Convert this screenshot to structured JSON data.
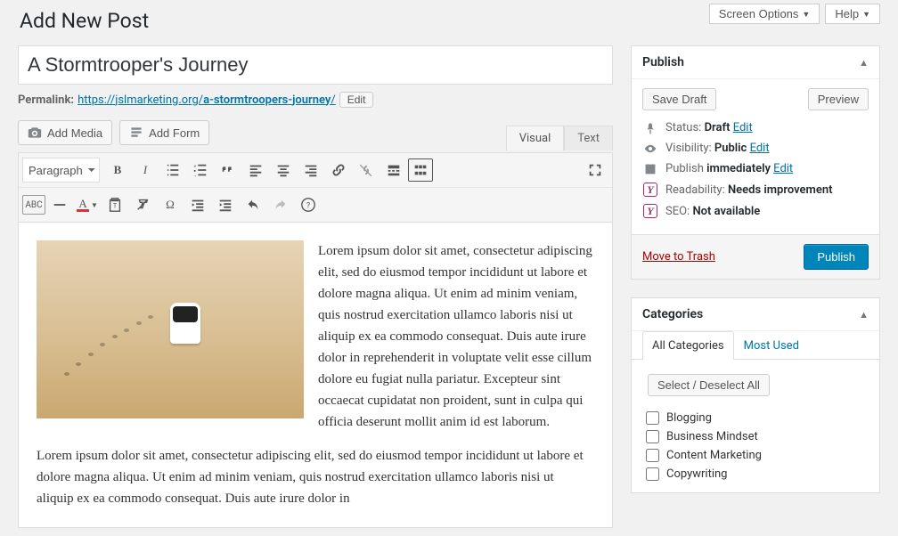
{
  "header": {
    "screen_options": "Screen Options",
    "help": "Help"
  },
  "page_title": "Add New Post",
  "post": {
    "title": "A Stormtrooper's Journey",
    "permalink_label": "Permalink:",
    "permalink_base": "https://jslmarketing.org/",
    "permalink_slug": "a-stormtroopers-journey",
    "permalink_trail": "/",
    "edit_btn": "Edit"
  },
  "media": {
    "add_media": "Add Media",
    "add_form": "Add Form"
  },
  "editor": {
    "tabs": {
      "visual": "Visual",
      "text": "Text"
    },
    "format_select": "Paragraph",
    "body_p1": "Lorem ipsum dolor sit amet, consectetur adipiscing elit, sed do eiusmod tempor incididunt ut labore et dolore magna aliqua. Ut enim ad minim veniam, quis nostrud exercitation ullamco laboris nisi ut aliquip ex ea commodo consequat. Duis aute irure dolor in reprehenderit in voluptate velit esse cillum dolore eu fugiat nulla pariatur. Excepteur sint occaecat cupidatat non proident, sunt in culpa qui officia deserunt mollit anim id est laborum.",
    "body_p2": "Lorem ipsum dolor sit amet, consectetur adipiscing elit, sed do eiusmod tempor incididunt ut labore et dolore magna aliqua. Ut enim ad minim veniam, quis nostrud exercitation ullamco laboris nisi ut aliquip ex ea commodo consequat. Duis aute irure dolor in"
  },
  "publish": {
    "title": "Publish",
    "save_draft": "Save Draft",
    "preview": "Preview",
    "status_label": "Status:",
    "status_value": "Draft",
    "visibility_label": "Visibility:",
    "visibility_value": "Public",
    "publish_label": "Publish",
    "publish_value": "immediately",
    "readability_label": "Readability:",
    "readability_value": "Needs improvement",
    "seo_label": "SEO:",
    "seo_value": "Not available",
    "edit": "Edit",
    "trash": "Move to Trash",
    "publish_btn": "Publish"
  },
  "categories": {
    "title": "Categories",
    "tabs": {
      "all": "All Categories",
      "most": "Most Used"
    },
    "select_all": "Select / Deselect All",
    "items": [
      "Blogging",
      "Business Mindset",
      "Content Marketing",
      "Copywriting"
    ]
  }
}
